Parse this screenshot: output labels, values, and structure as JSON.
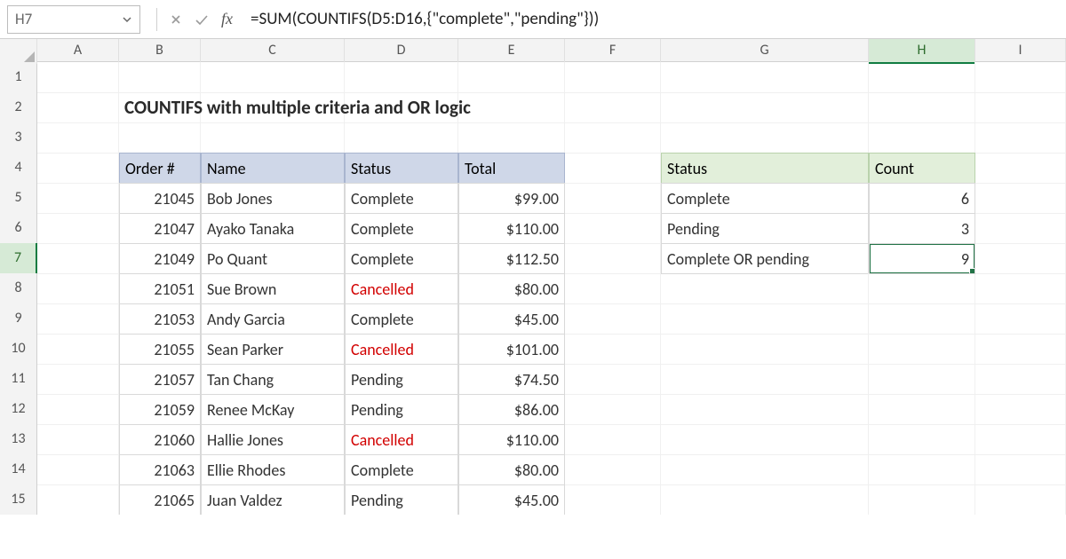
{
  "namebox": {
    "value": "H7"
  },
  "formula": "=SUM(COUNTIFS(D5:D16,{\"complete\",\"pending\"}))",
  "columns": [
    "A",
    "B",
    "C",
    "D",
    "E",
    "F",
    "G",
    "H",
    "I"
  ],
  "selected_column": "H",
  "row_numbers": [
    "1",
    "2",
    "3",
    "4",
    "5",
    "6",
    "7",
    "8",
    "9",
    "10",
    "11",
    "12",
    "13",
    "14",
    "15"
  ],
  "selected_row": "7",
  "title": "COUNTIFS with multiple criteria and OR logic",
  "table_headers": {
    "order": "Order #",
    "name": "Name",
    "status": "Status",
    "total": "Total"
  },
  "rows": [
    {
      "order": "21045",
      "name": "Bob Jones",
      "status": "Complete",
      "cancelled": false,
      "total": "$99.00"
    },
    {
      "order": "21047",
      "name": "Ayako Tanaka",
      "status": "Complete",
      "cancelled": false,
      "total": "$110.00"
    },
    {
      "order": "21049",
      "name": "Po Quant",
      "status": "Complete",
      "cancelled": false,
      "total": "$112.50"
    },
    {
      "order": "21051",
      "name": "Sue Brown",
      "status": "Cancelled",
      "cancelled": true,
      "total": "$80.00"
    },
    {
      "order": "21053",
      "name": "Andy Garcia",
      "status": "Complete",
      "cancelled": false,
      "total": "$45.00"
    },
    {
      "order": "21055",
      "name": "Sean Parker",
      "status": "Cancelled",
      "cancelled": true,
      "total": "$101.00"
    },
    {
      "order": "21057",
      "name": "Tan Chang",
      "status": "Pending",
      "cancelled": false,
      "total": "$74.50"
    },
    {
      "order": "21059",
      "name": "Renee McKay",
      "status": "Pending",
      "cancelled": false,
      "total": "$86.00"
    },
    {
      "order": "21060",
      "name": "Hallie Jones",
      "status": "Cancelled",
      "cancelled": true,
      "total": "$110.00"
    },
    {
      "order": "21063",
      "name": "Ellie Rhodes",
      "status": "Complete",
      "cancelled": false,
      "total": "$80.00"
    },
    {
      "order": "21065",
      "name": "Juan Valdez",
      "status": "Pending",
      "cancelled": false,
      "total": "$45.00"
    }
  ],
  "summary_headers": {
    "status": "Status",
    "count": "Count"
  },
  "summary": [
    {
      "status": "Complete",
      "count": "6"
    },
    {
      "status": "Pending",
      "count": "3"
    },
    {
      "status": "Complete OR pending",
      "count": "9"
    }
  ]
}
